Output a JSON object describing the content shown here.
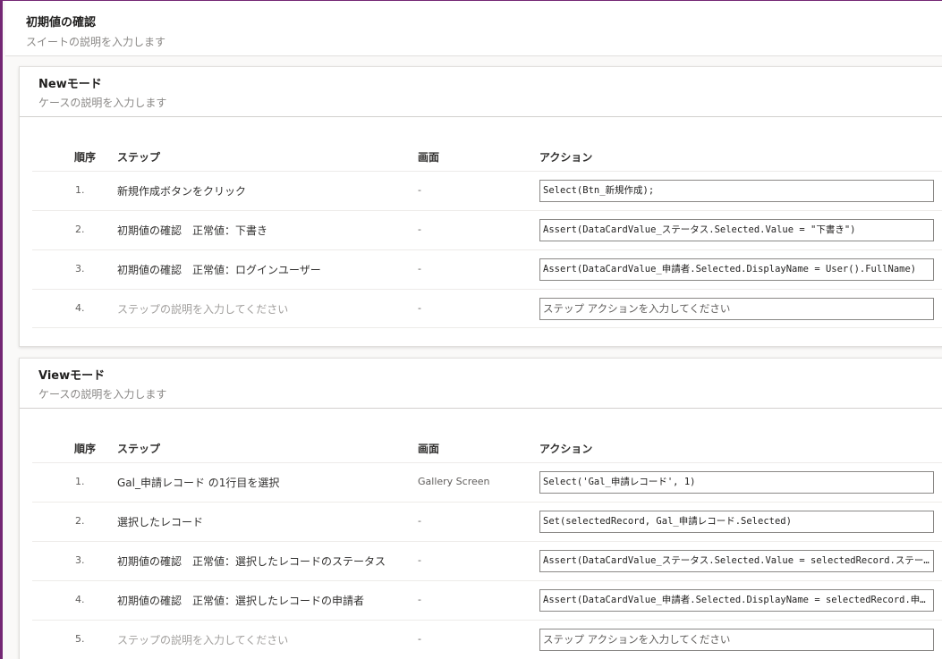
{
  "suite": {
    "title": "初期値の確認",
    "description_placeholder": "スイートの説明を入力します"
  },
  "columns": {
    "order": "順序",
    "step": "ステップ",
    "screen": "画面",
    "action": "アクション"
  },
  "cases": [
    {
      "title": "Newモード",
      "description_placeholder": "ケースの説明を入力します",
      "steps": [
        {
          "order": "1.",
          "step": "新規作成ボタンをクリック",
          "screen": "-",
          "action": "Select(Btn_新規作成);"
        },
        {
          "order": "2.",
          "step": "初期値の確認　正常値：下書き",
          "screen": "-",
          "action": "Assert(DataCardValue_ステータス.Selected.Value = \"下書き\")"
        },
        {
          "order": "3.",
          "step": "初期値の確認　正常値：ログインユーザー",
          "screen": "-",
          "action": "Assert(DataCardValue_申請者.Selected.DisplayName = User().FullName)"
        },
        {
          "order": "4.",
          "step": "ステップの説明を入力してください",
          "screen": "-",
          "action": "ステップ アクションを入力してください",
          "placeholder": true
        }
      ]
    },
    {
      "title": "Viewモード",
      "description_placeholder": "ケースの説明を入力します",
      "steps": [
        {
          "order": "1.",
          "step": "Gal_申請レコード の1行目を選択",
          "screen": "Gallery Screen",
          "action": "Select('Gal_申請レコード', 1)"
        },
        {
          "order": "2.",
          "step": "選択したレコード",
          "screen": "-",
          "action": "Set(selectedRecord, Gal_申請レコード.Selected)"
        },
        {
          "order": "3.",
          "step": "初期値の確認　正常値：選択したレコードのステータス",
          "screen": "-",
          "action": "Assert(DataCardValue_ステータス.Selected.Value = selectedRecord.ステータス.Value)"
        },
        {
          "order": "4.",
          "step": "初期値の確認　正常値：選択したレコードの申請者",
          "screen": "-",
          "action": "Assert(DataCardValue_申請者.Selected.DisplayName = selectedRecord.申請者.DisplayName)"
        },
        {
          "order": "5.",
          "step": "ステップの説明を入力してください",
          "screen": "-",
          "action": "ステップ アクションを入力してください",
          "placeholder": true
        }
      ]
    }
  ],
  "colors": {
    "accent": "#742774",
    "placeholder": "#a19f9d",
    "border": "#8a8886"
  }
}
